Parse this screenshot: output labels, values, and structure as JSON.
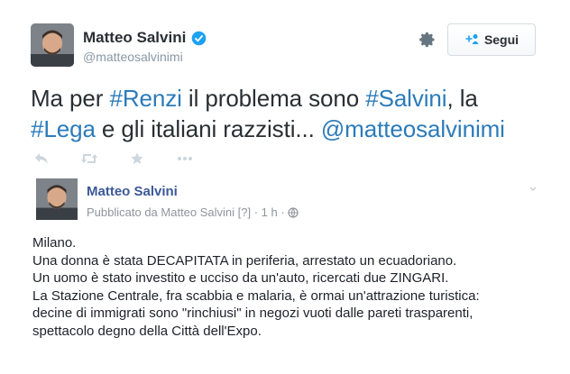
{
  "tweet": {
    "author_name": "Matteo Salvini",
    "handle": "@matteosalvinimi",
    "follow_label": "Segui",
    "text_parts": [
      {
        "text": "Ma per ",
        "type": "plain"
      },
      {
        "text": "#Renzi",
        "type": "hashtag"
      },
      {
        "text": " il problema sono ",
        "type": "plain"
      },
      {
        "text": "#Salvini",
        "type": "hashtag"
      },
      {
        "text": ", la",
        "type": "plain"
      },
      {
        "text": "#Lega",
        "type": "hashtag"
      },
      {
        "text": " e gli italiani razzisti... ",
        "type": "plain"
      },
      {
        "text": "@matteosalvinimi",
        "type": "mention"
      }
    ],
    "actions": [
      "reply-icon",
      "retweet-icon",
      "favorite-icon",
      "more-icon"
    ],
    "colors": {
      "link": "#2b7bb9",
      "text": "#292f33",
      "verified": "#1da1f2"
    }
  },
  "fb_post": {
    "author_name": "Matteo Salvini",
    "meta_text": "Pubblicato da Matteo Salvini [?] · 1 h ·",
    "body_lines": [
      "Milano.",
      "Una donna è stata DECAPITATA in periferia, arrestato un ecuadoriano.",
      "Un uomo è stato investito e ucciso da un'auto, ricercati due ZINGARI.",
      "La Stazione Centrale, fra scabbia e malaria, è ormai un'attrazione turistica:",
      "decine di immigrati sono \"rinchiusi\" in negozi vuoti dalle pareti trasparenti,",
      "spettacolo degno della Città dell'Expo."
    ],
    "colors": {
      "name": "#3b5998",
      "meta": "#90949c"
    }
  }
}
